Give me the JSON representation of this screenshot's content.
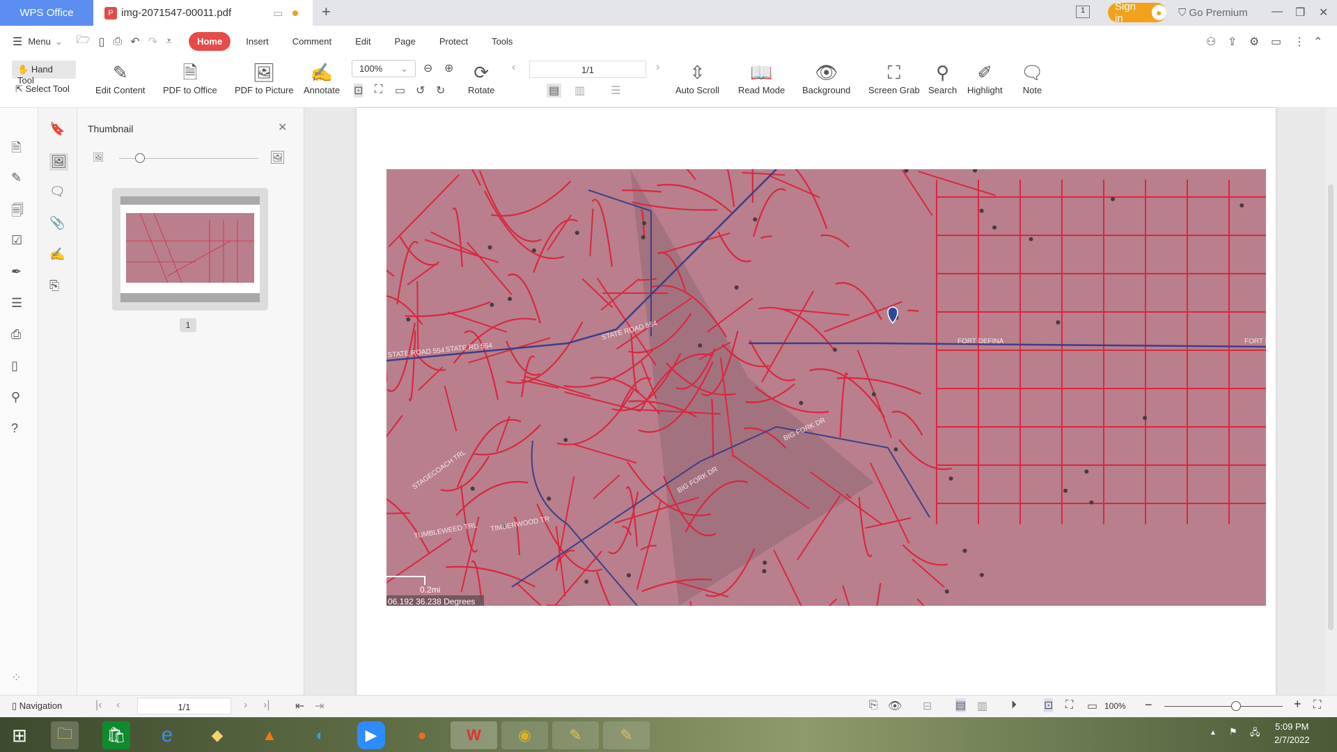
{
  "app": {
    "brand": "WPS Office",
    "tab_title": "img-2071547-00011.pdf",
    "sign_in": "Sign in",
    "go_premium": "Go Premium",
    "page_indicator": "1"
  },
  "menu": {
    "menu_label": "Menu",
    "tabs": [
      "Home",
      "Insert",
      "Comment",
      "Edit",
      "Page",
      "Protect",
      "Tools"
    ],
    "active": "Home"
  },
  "toolbar": {
    "hand_tool": "Hand Tool",
    "select_tool": "Select Tool",
    "edit_content": "Edit Content",
    "pdf_to_office": "PDF to Office",
    "pdf_to_picture": "PDF to Picture",
    "annotate": "Annotate",
    "zoom": "100%",
    "rotate": "Rotate",
    "page": "1/1",
    "auto_scroll": "Auto Scroll",
    "read_mode": "Read Mode",
    "background": "Background",
    "screen_grab": "Screen Grab",
    "search": "Search",
    "highlight": "Highlight",
    "note": "Note"
  },
  "thumbnail": {
    "title": "Thumbnail",
    "page_number": "1",
    "size_slider": 0.15
  },
  "map": {
    "scale": "0.2mi",
    "coords": "06.192 36.238 Degrees",
    "labels": [
      "STATE ROAD 554",
      "STATE ROAD 554",
      "FORT DEFINA",
      "FORT DE",
      "BIG FORK DR",
      "BIG FORK DR",
      "STAGECOACH TRL",
      "TUMBLEWEED TRL",
      "TIMBERWOOD TR",
      "STATE RD 554"
    ]
  },
  "bottom": {
    "navigation": "Navigation",
    "page": "1/1",
    "zoom": "100%",
    "zoom_slider": 0.5
  },
  "taskbar": {
    "time": "5:09 PM",
    "date": "2/7/2022"
  },
  "colors": {
    "accent": "#e64b4b",
    "brand": "#5b8ef0",
    "premium": "#f2a21a",
    "map_bg": "#b97f8c",
    "parcel": "#d8283e",
    "road": "#3a3f8a"
  }
}
